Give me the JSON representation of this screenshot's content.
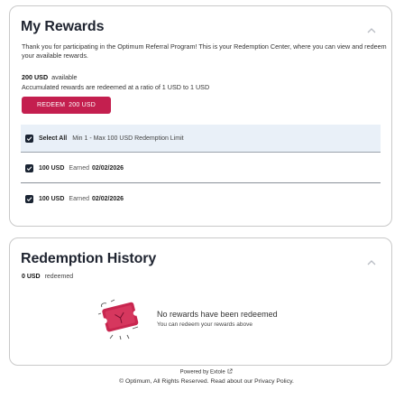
{
  "rewards": {
    "title": "My Rewards",
    "intro": "Thank you for participating in the Optimum Referral Program! This is your Redemption Center, where you can view and redeem your available rewards.",
    "available_amount": "200 USD",
    "available_label": "available",
    "ratio_text": "Accumulated rewards are redeemed at a ratio of 1 USD to 1 USD",
    "redeem_label": "REDEEM",
    "redeem_amount": "200 USD",
    "select_all_label": "Select All",
    "limit_text": "Min 1 - Max 100 USD Redemption Limit",
    "items": [
      {
        "amount": "100 USD",
        "earned_label": "Earned",
        "date": "02/02/2026"
      },
      {
        "amount": "100 USD",
        "earned_label": "Earned",
        "date": "02/02/2026"
      }
    ]
  },
  "history": {
    "title": "Redemption History",
    "redeemed_amount": "0 USD",
    "redeemed_label": "redeemed",
    "empty_title": "No rewards have been redeemed",
    "empty_subtitle": "You can redeem your rewards above"
  },
  "footer": {
    "powered_by": "Powered by Extole",
    "copyright": "© Optimum, All Rights Reserved. Read about our Privacy Policy."
  },
  "colors": {
    "accent": "#c41f4f",
    "selected_row_bg": "#e9f0f8",
    "checkbox": "#1a2433"
  },
  "icons": [
    "chevron-up-icon",
    "checkbox-checked-icon",
    "external-link-icon",
    "gift-ticket-illustration"
  ]
}
